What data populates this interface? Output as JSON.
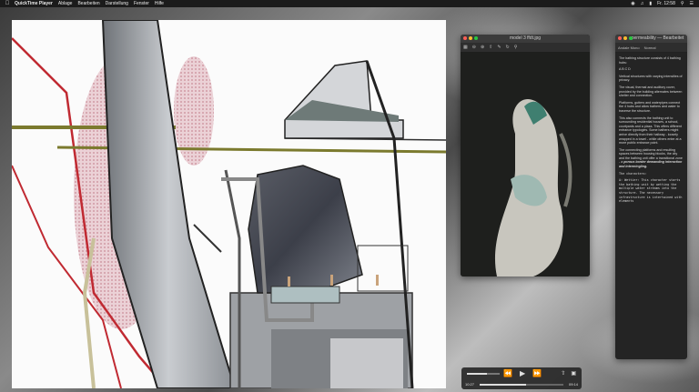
{
  "menubar": {
    "apple_icon": "apple-icon",
    "app_name": "QuickTime Player",
    "menus": [
      "Ablage",
      "Bearbeiten",
      "Darstellung",
      "Fenster",
      "Hilfe"
    ],
    "clock": "Fr. 12:58"
  },
  "preview_window": {
    "title": "model 3 ffdt.jpg"
  },
  "editor_window": {
    "title": "permeability — Bearbeitet",
    "toolbar_items": [
      "Andale Mono",
      "Normal"
    ],
    "paragraphs": [
      "The bathing structure consists of 4 bathing hubs:",
      "A B C D",
      "Vertical structures with varying intensities of privacy.",
      "The visual, thermal and auditory cover, provided by the building alternates between shelter and connection.",
      "Platforms, gutters and waterpipes connect the 4 hubs and allow bathers and water to traverse the structure.",
      "This also connects the bathing unit to surrounding residential houses, a school, courtyards and a plaza. This offers different entrance typologies. Some bathers might arrive directly from their hallway - loosely wrapped in a towel - while others enter at a more public entrance point.",
      "The connecting platforms and resulting spaces between housing blocks, the city and the bathing unit offer a transitional zone - a"
    ],
    "bold_phrase": "porous border demanding interaction and intermingling.",
    "characters_heading": "The characters:",
    "mono_text": "A: Wettier: This character starts the bathing unit by wetting the multiple water streams into the structure. The necessary infrastructure is intertwined with elements"
  },
  "quicktime_controls": {
    "time_elapsed": "10:27",
    "time_remaining": "09:14",
    "volume_fraction": 0.6,
    "progress_fraction": 0.55,
    "rewind_icon": "rewind-icon",
    "play_icon": "play-icon",
    "forward_icon": "fast-forward-icon"
  }
}
